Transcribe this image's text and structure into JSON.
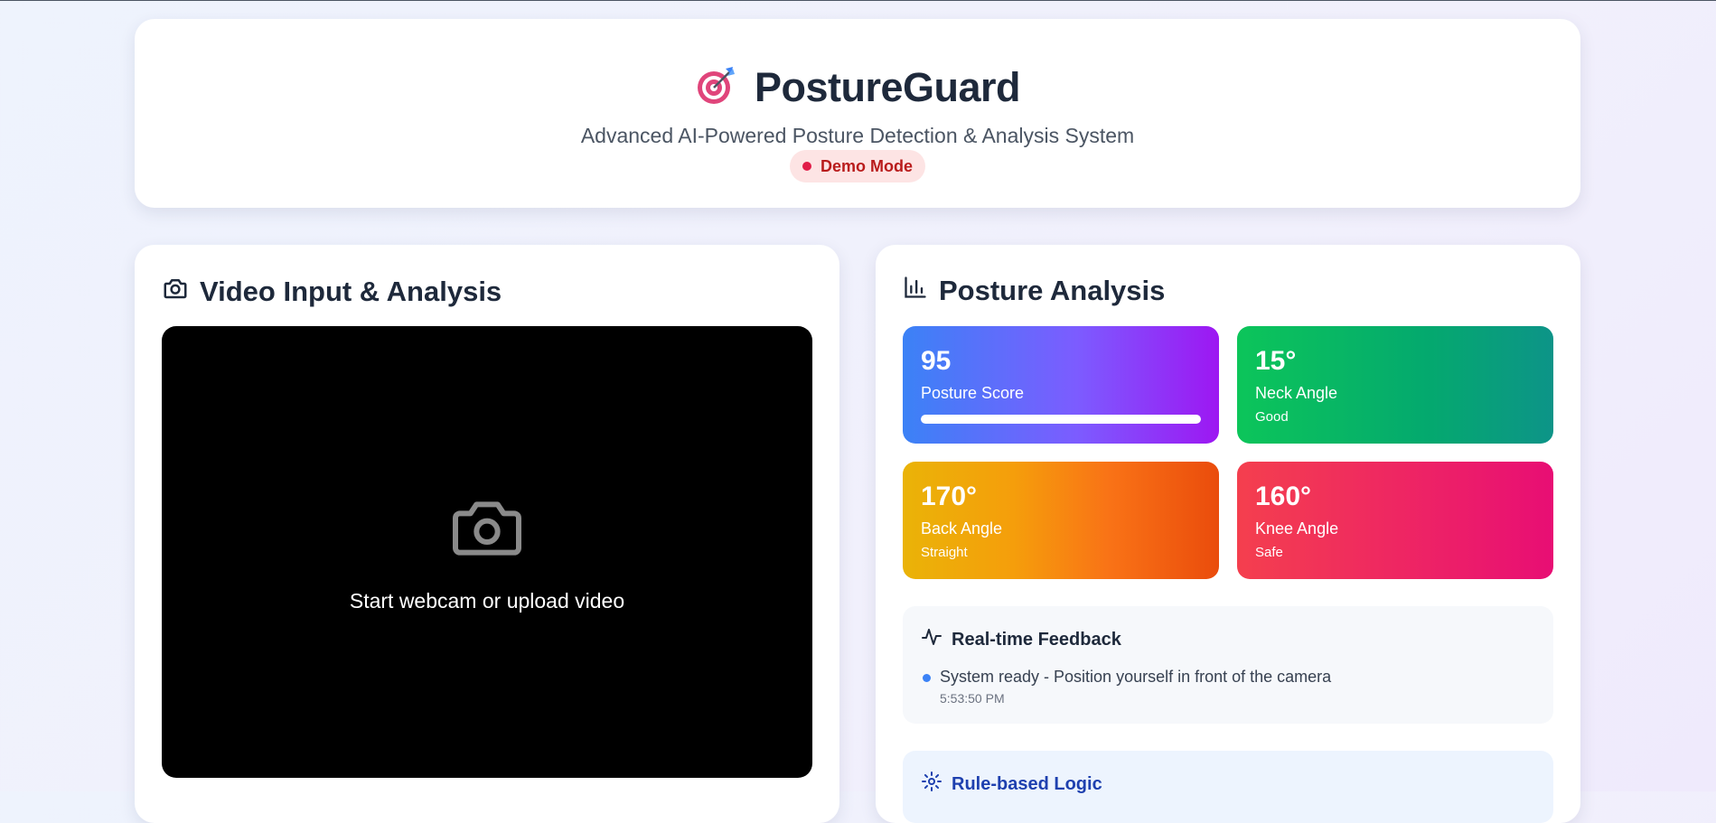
{
  "header": {
    "title": "PostureGuard",
    "subtitle": "Advanced AI-Powered Posture Detection & Analysis System",
    "badge": "Demo Mode",
    "logo_icon": "target-icon"
  },
  "video_panel": {
    "title": "Video Input & Analysis",
    "title_icon": "camera-icon",
    "placeholder_icon": "camera-icon",
    "placeholder_text": "Start webcam or upload video"
  },
  "analysis_panel": {
    "title": "Posture Analysis",
    "title_icon": "bar-chart-icon",
    "stats": {
      "score": {
        "value": "95",
        "label": "Posture Score",
        "progress": 1.0
      },
      "neck": {
        "value": "15°",
        "label": "Neck Angle",
        "status": "Good"
      },
      "back": {
        "value": "170°",
        "label": "Back Angle",
        "status": "Straight"
      },
      "knee": {
        "value": "160°",
        "label": "Knee Angle",
        "status": "Safe"
      }
    },
    "feedback": {
      "title": "Real-time Feedback",
      "icon": "activity-icon",
      "items": [
        {
          "message": "System ready - Position yourself in front of the camera",
          "time": "5:53:50 PM"
        }
      ]
    },
    "rules": {
      "title": "Rule-based Logic",
      "icon": "gear-icon"
    }
  },
  "colors": {
    "title": "#1e293b",
    "badge_bg": "#fde4e4",
    "badge_text": "#b91c1c",
    "feedback_dot": "#3b82f6",
    "rules_title": "#1e40af"
  }
}
